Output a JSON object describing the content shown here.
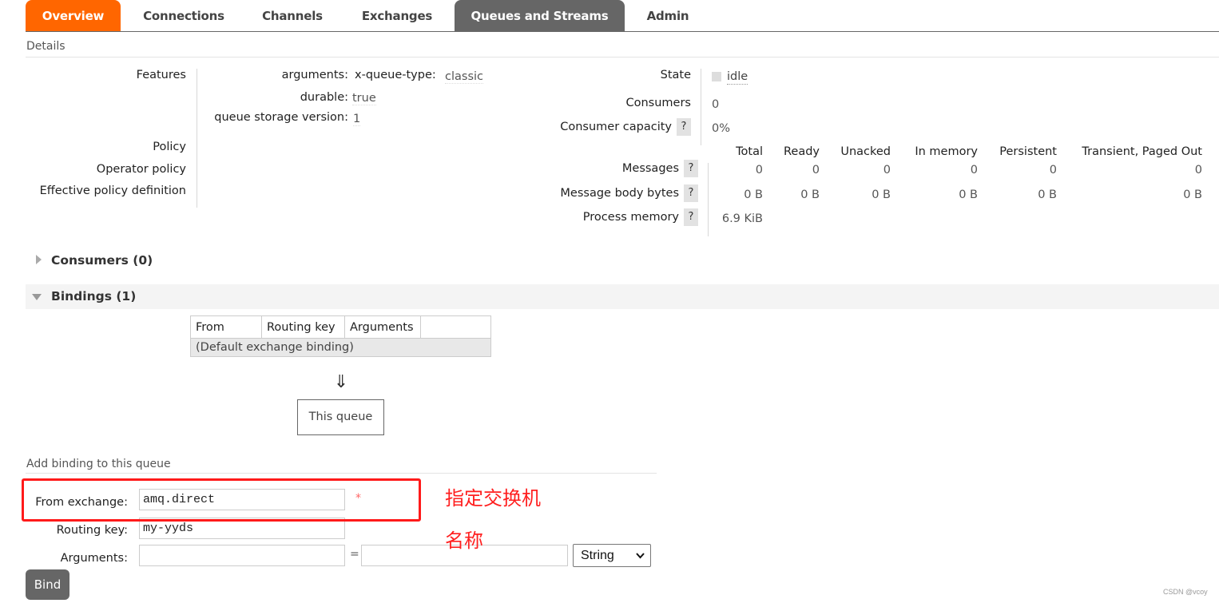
{
  "tabs": [
    {
      "label": "Overview",
      "state": "highlight"
    },
    {
      "label": "Connections",
      "state": "normal"
    },
    {
      "label": "Channels",
      "state": "normal"
    },
    {
      "label": "Exchanges",
      "state": "normal"
    },
    {
      "label": "Queues and Streams",
      "state": "active"
    },
    {
      "label": "Admin",
      "state": "normal"
    }
  ],
  "details": {
    "heading": "Details",
    "features_label": "Features",
    "features": [
      {
        "key": "arguments:",
        "subkey": "x-queue-type:",
        "value": "classic"
      },
      {
        "key": "durable:",
        "value": "true"
      },
      {
        "key": "queue storage version:",
        "value": "1"
      }
    ],
    "policy_label": "Policy",
    "operator_policy_label": "Operator policy",
    "effective_policy_label": "Effective policy definition",
    "state_label": "State",
    "state_value": "idle",
    "consumers_label": "Consumers",
    "consumers_value": "0",
    "consumer_capacity_label": "Consumer capacity",
    "consumer_capacity_value": "0%",
    "help_glyph": "?",
    "stats": {
      "columns": [
        "Total",
        "Ready",
        "Unacked",
        "In memory",
        "Persistent",
        "Transient, Paged Out"
      ],
      "rows": [
        {
          "label": "Messages",
          "values": [
            "0",
            "0",
            "0",
            "0",
            "0",
            "0"
          ]
        },
        {
          "label": "Message body bytes",
          "values": [
            "0 B",
            "0 B",
            "0 B",
            "0 B",
            "0 B",
            "0 B"
          ]
        },
        {
          "label": "Process memory",
          "values": [
            "6.9 KiB"
          ]
        }
      ]
    }
  },
  "consumers_section": {
    "title": "Consumers (0)",
    "expanded": false
  },
  "bindings_section": {
    "title": "Bindings (1)",
    "expanded": true,
    "table": {
      "headers": [
        "From",
        "Routing key",
        "Arguments",
        ""
      ],
      "rows": [
        [
          "(Default exchange binding)"
        ]
      ]
    },
    "arrow": "⇓",
    "this_queue": "This queue"
  },
  "add_binding": {
    "heading": "Add binding to this queue",
    "from_exchange_label": "From exchange:",
    "from_exchange_value": "amq.direct",
    "required_mark": "*",
    "routing_key_label": "Routing key:",
    "routing_key_value": "my-yyds",
    "arguments_label": "Arguments:",
    "arguments_key": "",
    "arguments_eq": "=",
    "arguments_value": "",
    "type_selected": "String",
    "bind_label": "Bind"
  },
  "annotation": {
    "line1": "指定交换机",
    "line2": "名称",
    "color": "#ff1a1a"
  },
  "watermark": "CSDN @vcoy"
}
